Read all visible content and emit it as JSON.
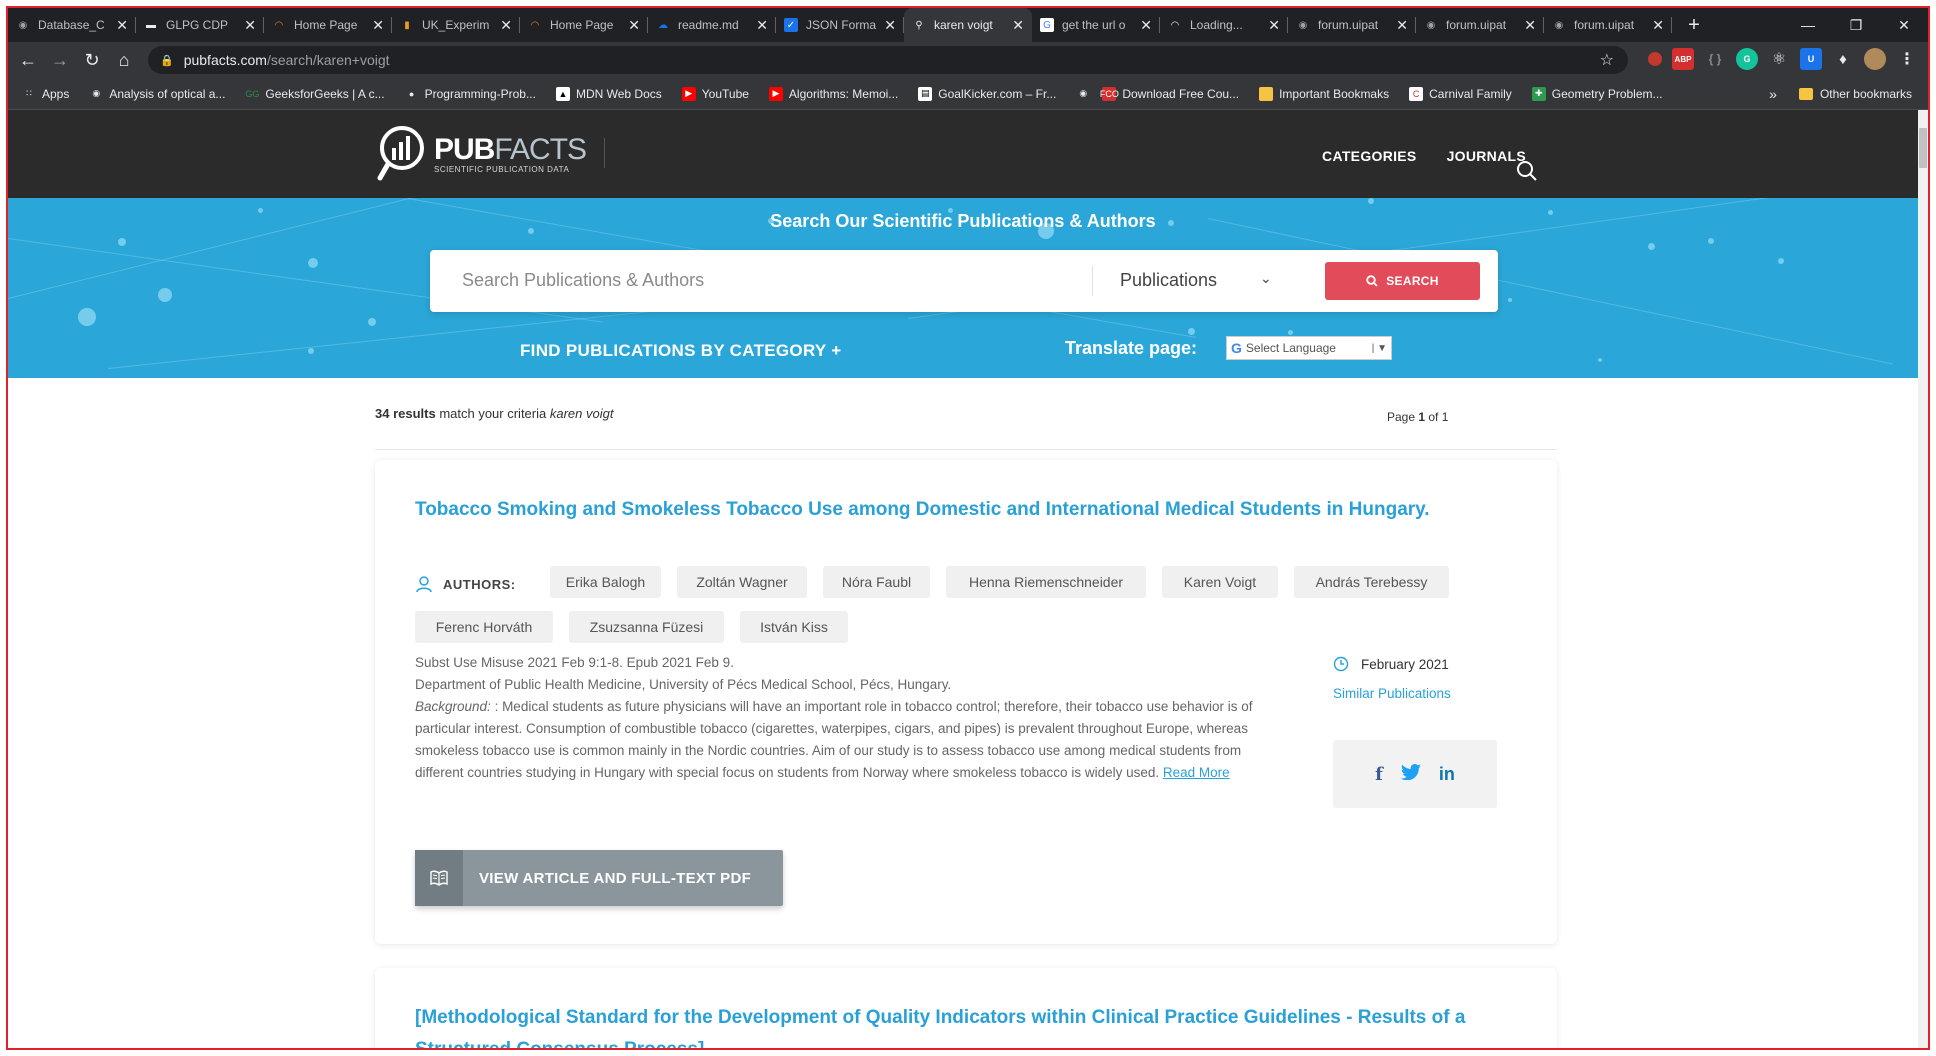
{
  "browser": {
    "tabs": [
      {
        "title": "Database_C",
        "icon": "globe-icon",
        "active": false
      },
      {
        "title": "GLPG CDP",
        "icon": "glpg-icon",
        "active": false
      },
      {
        "title": "Home Page",
        "icon": "loading-orange-icon",
        "active": false
      },
      {
        "title": "UK_Experim",
        "icon": "document-orange-icon",
        "active": false
      },
      {
        "title": "Home Page",
        "icon": "loading-orange-icon",
        "active": false
      },
      {
        "title": "readme.md",
        "icon": "onedrive-icon",
        "active": false
      },
      {
        "title": "JSON Forma",
        "icon": "checkbox-icon",
        "active": false
      },
      {
        "title": "karen voigt",
        "icon": "pubfacts-icon",
        "active": true
      },
      {
        "title": "get the url o",
        "icon": "google-icon",
        "active": false
      },
      {
        "title": "Loading...",
        "icon": "spinner-icon",
        "active": false
      },
      {
        "title": "forum.uipat",
        "icon": "globe-icon",
        "active": false
      },
      {
        "title": "forum.uipat",
        "icon": "globe-icon",
        "active": false
      },
      {
        "title": "forum.uipat",
        "icon": "globe-icon",
        "active": false
      }
    ],
    "url_host": "pubfacts.com",
    "url_path": "/search/karen+voigt",
    "bookmarks": [
      {
        "label": "Apps",
        "icon": "apps-grid-icon"
      },
      {
        "label": "Analysis of optical a...",
        "icon": "globe-icon"
      },
      {
        "label": "GeeksforGeeks | A c...",
        "icon": "gfg-icon"
      },
      {
        "label": "Programming-Prob...",
        "icon": "github-icon"
      },
      {
        "label": "MDN Web Docs",
        "icon": "mdn-icon"
      },
      {
        "label": "YouTube",
        "icon": "youtube-icon"
      },
      {
        "label": "Algorithms: Memoi...",
        "icon": "youtube-icon"
      },
      {
        "label": "GoalKicker.com – Fr...",
        "icon": "goalkicker-icon"
      },
      {
        "label": "",
        "icon": "globe-icon"
      },
      {
        "label": "Download Free Cou...",
        "icon": "fcd-icon"
      },
      {
        "label": "Important Bookmaks",
        "icon": "folder-icon"
      },
      {
        "label": "Carnival Family",
        "icon": "carnival-icon"
      },
      {
        "label": "Geometry Problem...",
        "icon": "geometry-icon"
      }
    ],
    "bookmarks_more": "»",
    "other_bookmarks": "Other bookmarks"
  },
  "site": {
    "logo_pub": "PUB",
    "logo_facts": "FACTS",
    "logo_tagline": "SCIENTIFIC PUBLICATION DATA",
    "nav": [
      "CATEGORIES",
      "JOURNALS"
    ],
    "hero_title": "Search Our Scientific Publications & Authors",
    "search_placeholder": "Search Publications & Authors",
    "search_scope": "Publications",
    "search_button": "SEARCH",
    "find_by_category": "FIND PUBLICATIONS BY CATEGORY +",
    "translate_label": "Translate page:",
    "language_select": "Select Language"
  },
  "results": {
    "count": "34 results",
    "match_text": " match your criteria ",
    "query": "karen voigt",
    "page_label": "Page ",
    "page_current": "1",
    "page_of": " of 1"
  },
  "articles": [
    {
      "title": "Tobacco Smoking and Smokeless Tobacco Use among Domestic and International Medical Students in Hungary.",
      "authors_label": "AUTHORS:",
      "authors": [
        "Erika Balogh",
        "Zoltán Wagner",
        "Nóra Faubl",
        "Henna Riemenschneider",
        "Karen Voigt",
        "András Terebessy",
        "Ferenc Horváth",
        "Zsuzsanna Füzesi",
        "István Kiss"
      ],
      "citation": "Subst Use Misuse 2021 Feb 9:1-8. Epub 2021 Feb 9.",
      "affiliation": "Department of Public Health Medicine, University of Pécs Medical School, Pécs, Hungary.",
      "abstract_label": "Background:",
      "abstract": " : Medical students as future physicians will have an important role in tobacco control; therefore, their tobacco use behavior is of particular interest. Consumption of combustible tobacco (cigarettes, waterpipes, cigars, and pipes) is prevalent throughout Europe, whereas smokeless tobacco use is common mainly in the Nordic countries. Aim of our study is to assess tobacco use among medical students from different countries studying in Hungary with special focus on students from Norway where smokeless tobacco is widely used.",
      "read_more": "Read More",
      "date": "February 2021",
      "similar": "Similar Publications",
      "view_button": "VIEW ARTICLE AND FULL-TEXT PDF"
    },
    {
      "title": "[Methodological Standard for the Development of Quality Indicators within Clinical Practice Guidelines - Results of a Structured Consensus Process]."
    }
  ],
  "colors": {
    "accent": "#2aa0d6",
    "hero": "#2aa7d8",
    "search_button": "#e24b5a",
    "header": "#2b2b2b"
  }
}
